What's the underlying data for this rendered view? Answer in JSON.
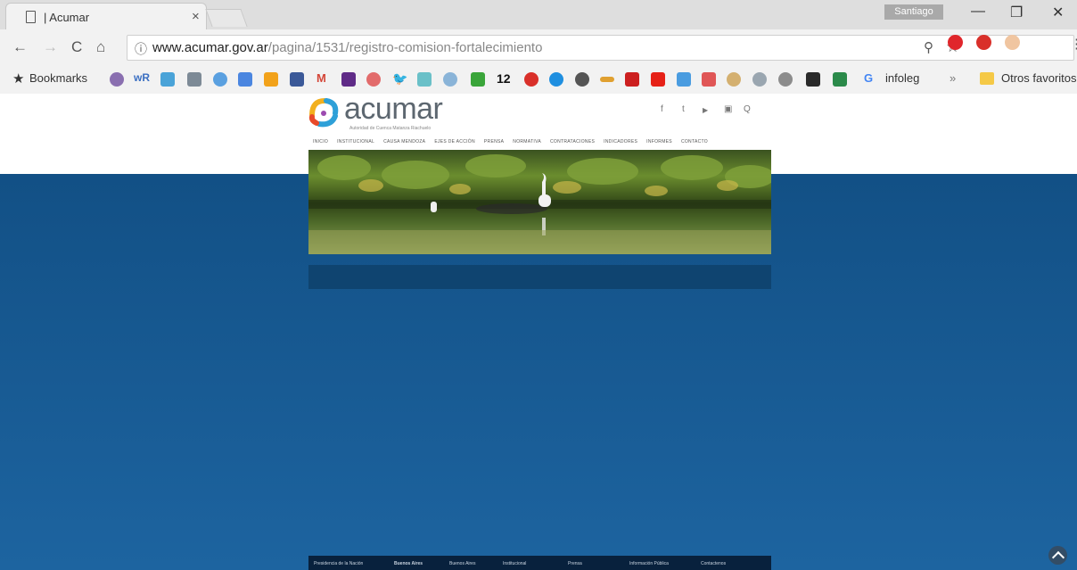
{
  "browser": {
    "tab_title": "| Acumar",
    "tab_close": "×",
    "user_name": "Santiago",
    "minimize": "—",
    "maximize": "❐",
    "close": "✕",
    "back": "←",
    "forward": "→",
    "reload": "C",
    "home": "⌂",
    "url_host": "www.acumar.gov.ar",
    "url_path": "/pagina/1531/registro-comision-fortalecimiento",
    "zoom_icon": "magnifier-icon",
    "bookmark_icon": "star-icon"
  },
  "bookmarks": {
    "label": "Bookmarks",
    "wr": "wR",
    "twelve": "12",
    "g_letter": "G",
    "infoleg": "infoleg",
    "more": "»",
    "others": "Otros favoritos"
  },
  "site": {
    "logo_text": "acumar",
    "logo_sub": "Autoridad de Cuenca Matanza Riachuelo",
    "social": [
      "f",
      "t",
      "▶",
      "▣",
      "Q"
    ],
    "nav": [
      "INICIO",
      "INSTITUCIONAL",
      "CAUSA MENDOZA",
      "EJES DE ACCIÓN",
      "PRENSA",
      "NORMATIVA",
      "CONTRATACIONES",
      "INDICADORES",
      "INFORMES",
      "CONTACTO"
    ],
    "footer": [
      "Presidencia de la Nación",
      "Buenos Aires",
      "Buenos Aires",
      "Institucional",
      "Prensa",
      "Información Pública",
      "Contactenos"
    ]
  },
  "colors": {
    "page_gradient_top": "#104c80",
    "page_gradient_bottom": "#1d64a0",
    "footer": "#08213d"
  }
}
